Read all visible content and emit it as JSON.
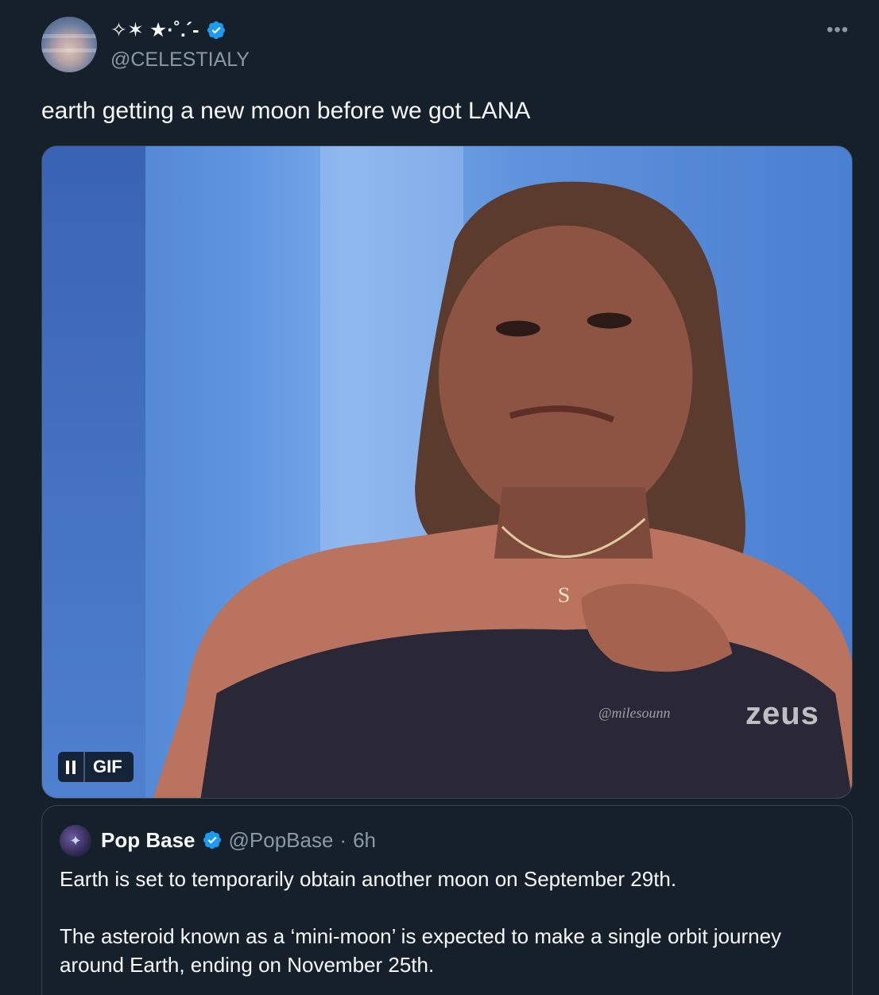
{
  "author": {
    "display_name": "✧✶ ★·˚.´-",
    "handle": "@CELESTIALY"
  },
  "more_label": "•••",
  "tweet_text": "earth getting a new moon before we got LANA",
  "media": {
    "badge_label": "GIF",
    "watermark_handle": "@milesounn",
    "watermark_brand": "zeus"
  },
  "quoted": {
    "name": "Pop Base",
    "handle": "@PopBase",
    "separator": "·",
    "time": "6h",
    "paragraph_1": "Earth is set to temporarily obtain another moon on September 29th.",
    "paragraph_2": "The asteroid known as a ‘mini-moon’ is expected to make a single orbit journey around Earth, ending on November 25th."
  },
  "colors": {
    "background": "#15202b",
    "verified": "#1d9bf0",
    "secondary_text": "#8b98a5",
    "border": "#38444d"
  }
}
